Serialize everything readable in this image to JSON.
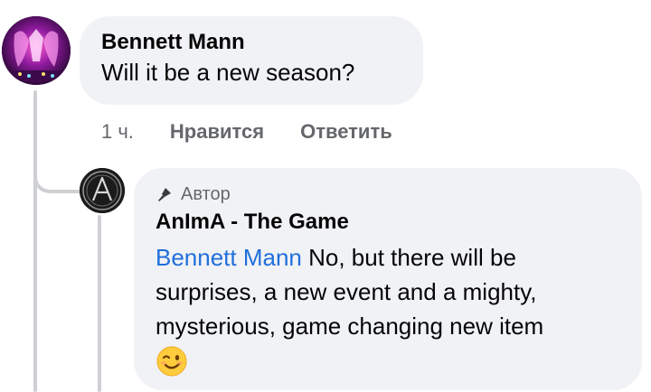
{
  "comment": {
    "author": "Bennett Mann",
    "text": "Will it be a new season?",
    "time": "1 ч.",
    "like_label": "Нравится",
    "reply_label": "Ответить"
  },
  "reply": {
    "role_badge": "Автор",
    "author": "AnImA - The Game",
    "mention": "Bennett Mann",
    "text": " No, but there will be surprises, a new event and a mighty, mysterious, game changing new item",
    "emoji": "winking-face"
  },
  "colors": {
    "bubble_bg": "#f0f2f5",
    "secondary_text": "#65676b",
    "mention_link": "#216fdb",
    "thread_line": "#ced0d4"
  },
  "icons": {
    "role_icon": "microphone-icon"
  }
}
